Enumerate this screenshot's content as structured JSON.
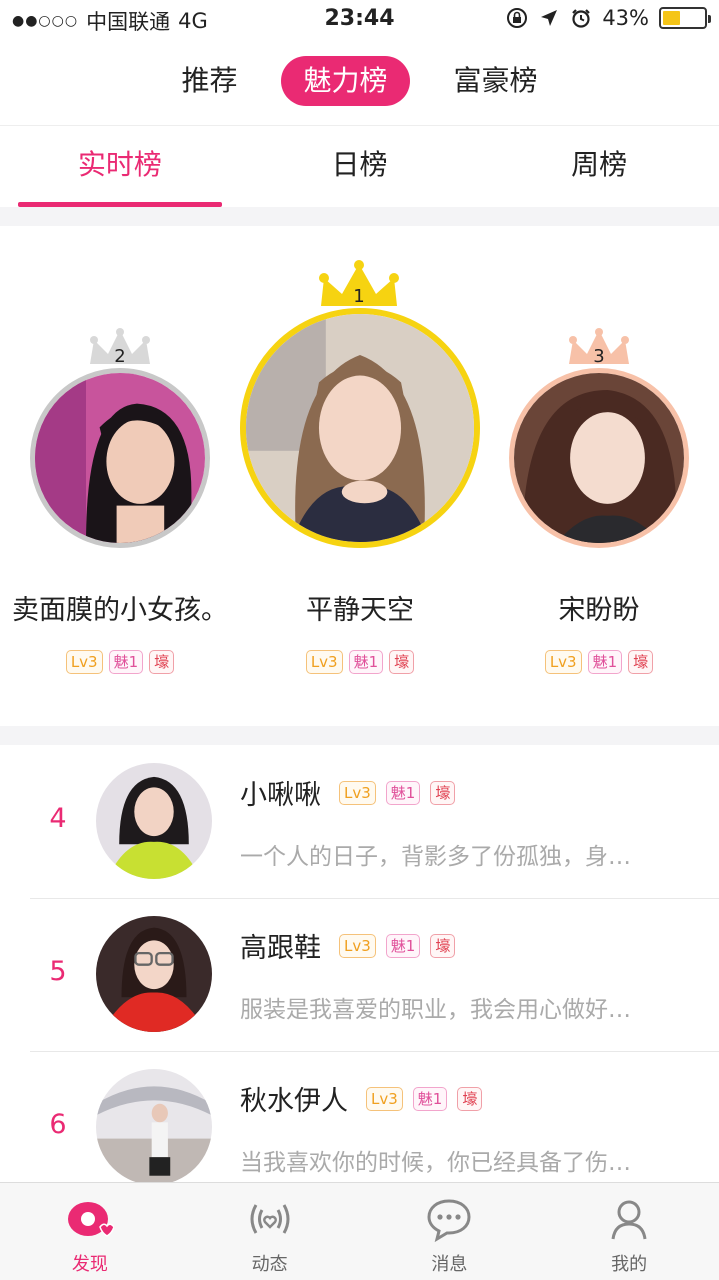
{
  "status_bar": {
    "signal": "●●○○○",
    "carrier": "中国联通",
    "network": "4G",
    "time": "23:44",
    "battery_percent": "43%",
    "battery_level": 0.43
  },
  "top_tabs": [
    {
      "label": "推荐",
      "active": false
    },
    {
      "label": "魅力榜",
      "active": true
    },
    {
      "label": "富豪榜",
      "active": false
    }
  ],
  "sub_tabs": [
    {
      "label": "实时榜",
      "active": true
    },
    {
      "label": "日榜",
      "active": false
    },
    {
      "label": "周榜",
      "active": false
    }
  ],
  "podium": {
    "first": {
      "rank": "1",
      "name": "平静天空",
      "lv": "Lv3",
      "charm": "魅1",
      "rich": "壕"
    },
    "second": {
      "rank": "2",
      "name": "卖面膜的小女孩。",
      "lv": "Lv3",
      "charm": "魅1",
      "rich": "壕"
    },
    "third": {
      "rank": "3",
      "name": "宋盼盼",
      "lv": "Lv3",
      "charm": "魅1",
      "rich": "壕"
    }
  },
  "ranking": [
    {
      "rank": "4",
      "name": "小啾啾",
      "lv": "Lv3",
      "charm": "魅1",
      "rich": "壕",
      "bio": "一个人的日子，背影多了份孤独，身…"
    },
    {
      "rank": "5",
      "name": "高跟鞋",
      "lv": "Lv3",
      "charm": "魅1",
      "rich": "壕",
      "bio": "服装是我喜爱的职业，我会用心做好…"
    },
    {
      "rank": "6",
      "name": "秋水伊人",
      "lv": "Lv3",
      "charm": "魅1",
      "rich": "壕",
      "bio": "当我喜欢你的时候，你已经具备了伤…"
    }
  ],
  "bottom_nav": [
    {
      "label": "发现",
      "icon": "discover-icon",
      "active": true
    },
    {
      "label": "动态",
      "icon": "feed-icon",
      "active": false
    },
    {
      "label": "消息",
      "icon": "message-icon",
      "active": false
    },
    {
      "label": "我的",
      "icon": "profile-icon",
      "active": false
    }
  ],
  "colors": {
    "accent": "#ea2a73",
    "gold": "#f6d311",
    "silver": "#c8c8c8",
    "bronze": "#f7c1a8"
  }
}
